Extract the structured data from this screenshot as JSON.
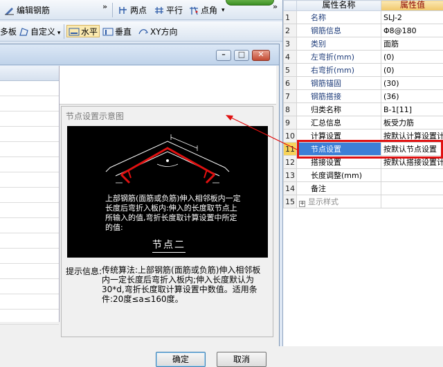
{
  "toolbar1": {
    "edit_rebar": "编辑钢筋",
    "two_points": "两点",
    "parallel": "平行",
    "point_angle": "点角"
  },
  "toolbar2": {
    "slab_partial": "多板",
    "custom": "自定义",
    "horizontal": "水平",
    "vertical": "垂直",
    "xy_direction": "XY方向"
  },
  "dialog": {
    "node_title": "节点设置示意图",
    "diagram_text": "上部钢筋(面筋或负筋)伸入相邻板内一定长度后弯折入板内:伸入的长度取节点上所输入的值,弯折长度取计算设置中所定的值:",
    "diagram_node": "节点二",
    "hint_label": "提示信息:",
    "hint_text": "传统算法:上部钢筋(面筋或负筋)伸入相邻板内一定长度后弯折入板内;伸入长度默认为30*d,弯折长度取计算设置中数值。适用条件:20度≤a≤160度。",
    "ok": "确定",
    "cancel": "取消"
  },
  "props": {
    "header_name": "属性名称",
    "header_value": "属性值",
    "rows": [
      {
        "num": "1",
        "name": "名称",
        "value": "SLJ-2"
      },
      {
        "num": "2",
        "name": "钢筋信息",
        "value": "Φ8@180"
      },
      {
        "num": "3",
        "name": "类别",
        "value": "面筋"
      },
      {
        "num": "4",
        "name": "左弯折(mm)",
        "value": "(0)"
      },
      {
        "num": "5",
        "name": "右弯折(mm)",
        "value": "(0)"
      },
      {
        "num": "6",
        "name": "钢筋锚固",
        "value": "(30)"
      },
      {
        "num": "7",
        "name": "钢筋搭接",
        "value": "(36)"
      },
      {
        "num": "8",
        "name": "归类名称",
        "value": "B-1[11]"
      },
      {
        "num": "9",
        "name": "汇总信息",
        "value": "板受力筋"
      },
      {
        "num": "10",
        "name": "计算设置",
        "value": "按默认计算设置计"
      },
      {
        "num": "11",
        "name": "节点设置",
        "value": "按默认节点设置"
      },
      {
        "num": "12",
        "name": "搭接设置",
        "value": "按默认搭接设置计"
      },
      {
        "num": "13",
        "name": "长度调整(mm)",
        "value": ""
      },
      {
        "num": "14",
        "name": "备注",
        "value": ""
      },
      {
        "num": "15",
        "name": "显示样式",
        "value": ""
      }
    ]
  },
  "colors": {
    "highlight_box": "#e01010",
    "selected_row": "#3d7fd6",
    "diagram_rebar": "#e01010"
  }
}
